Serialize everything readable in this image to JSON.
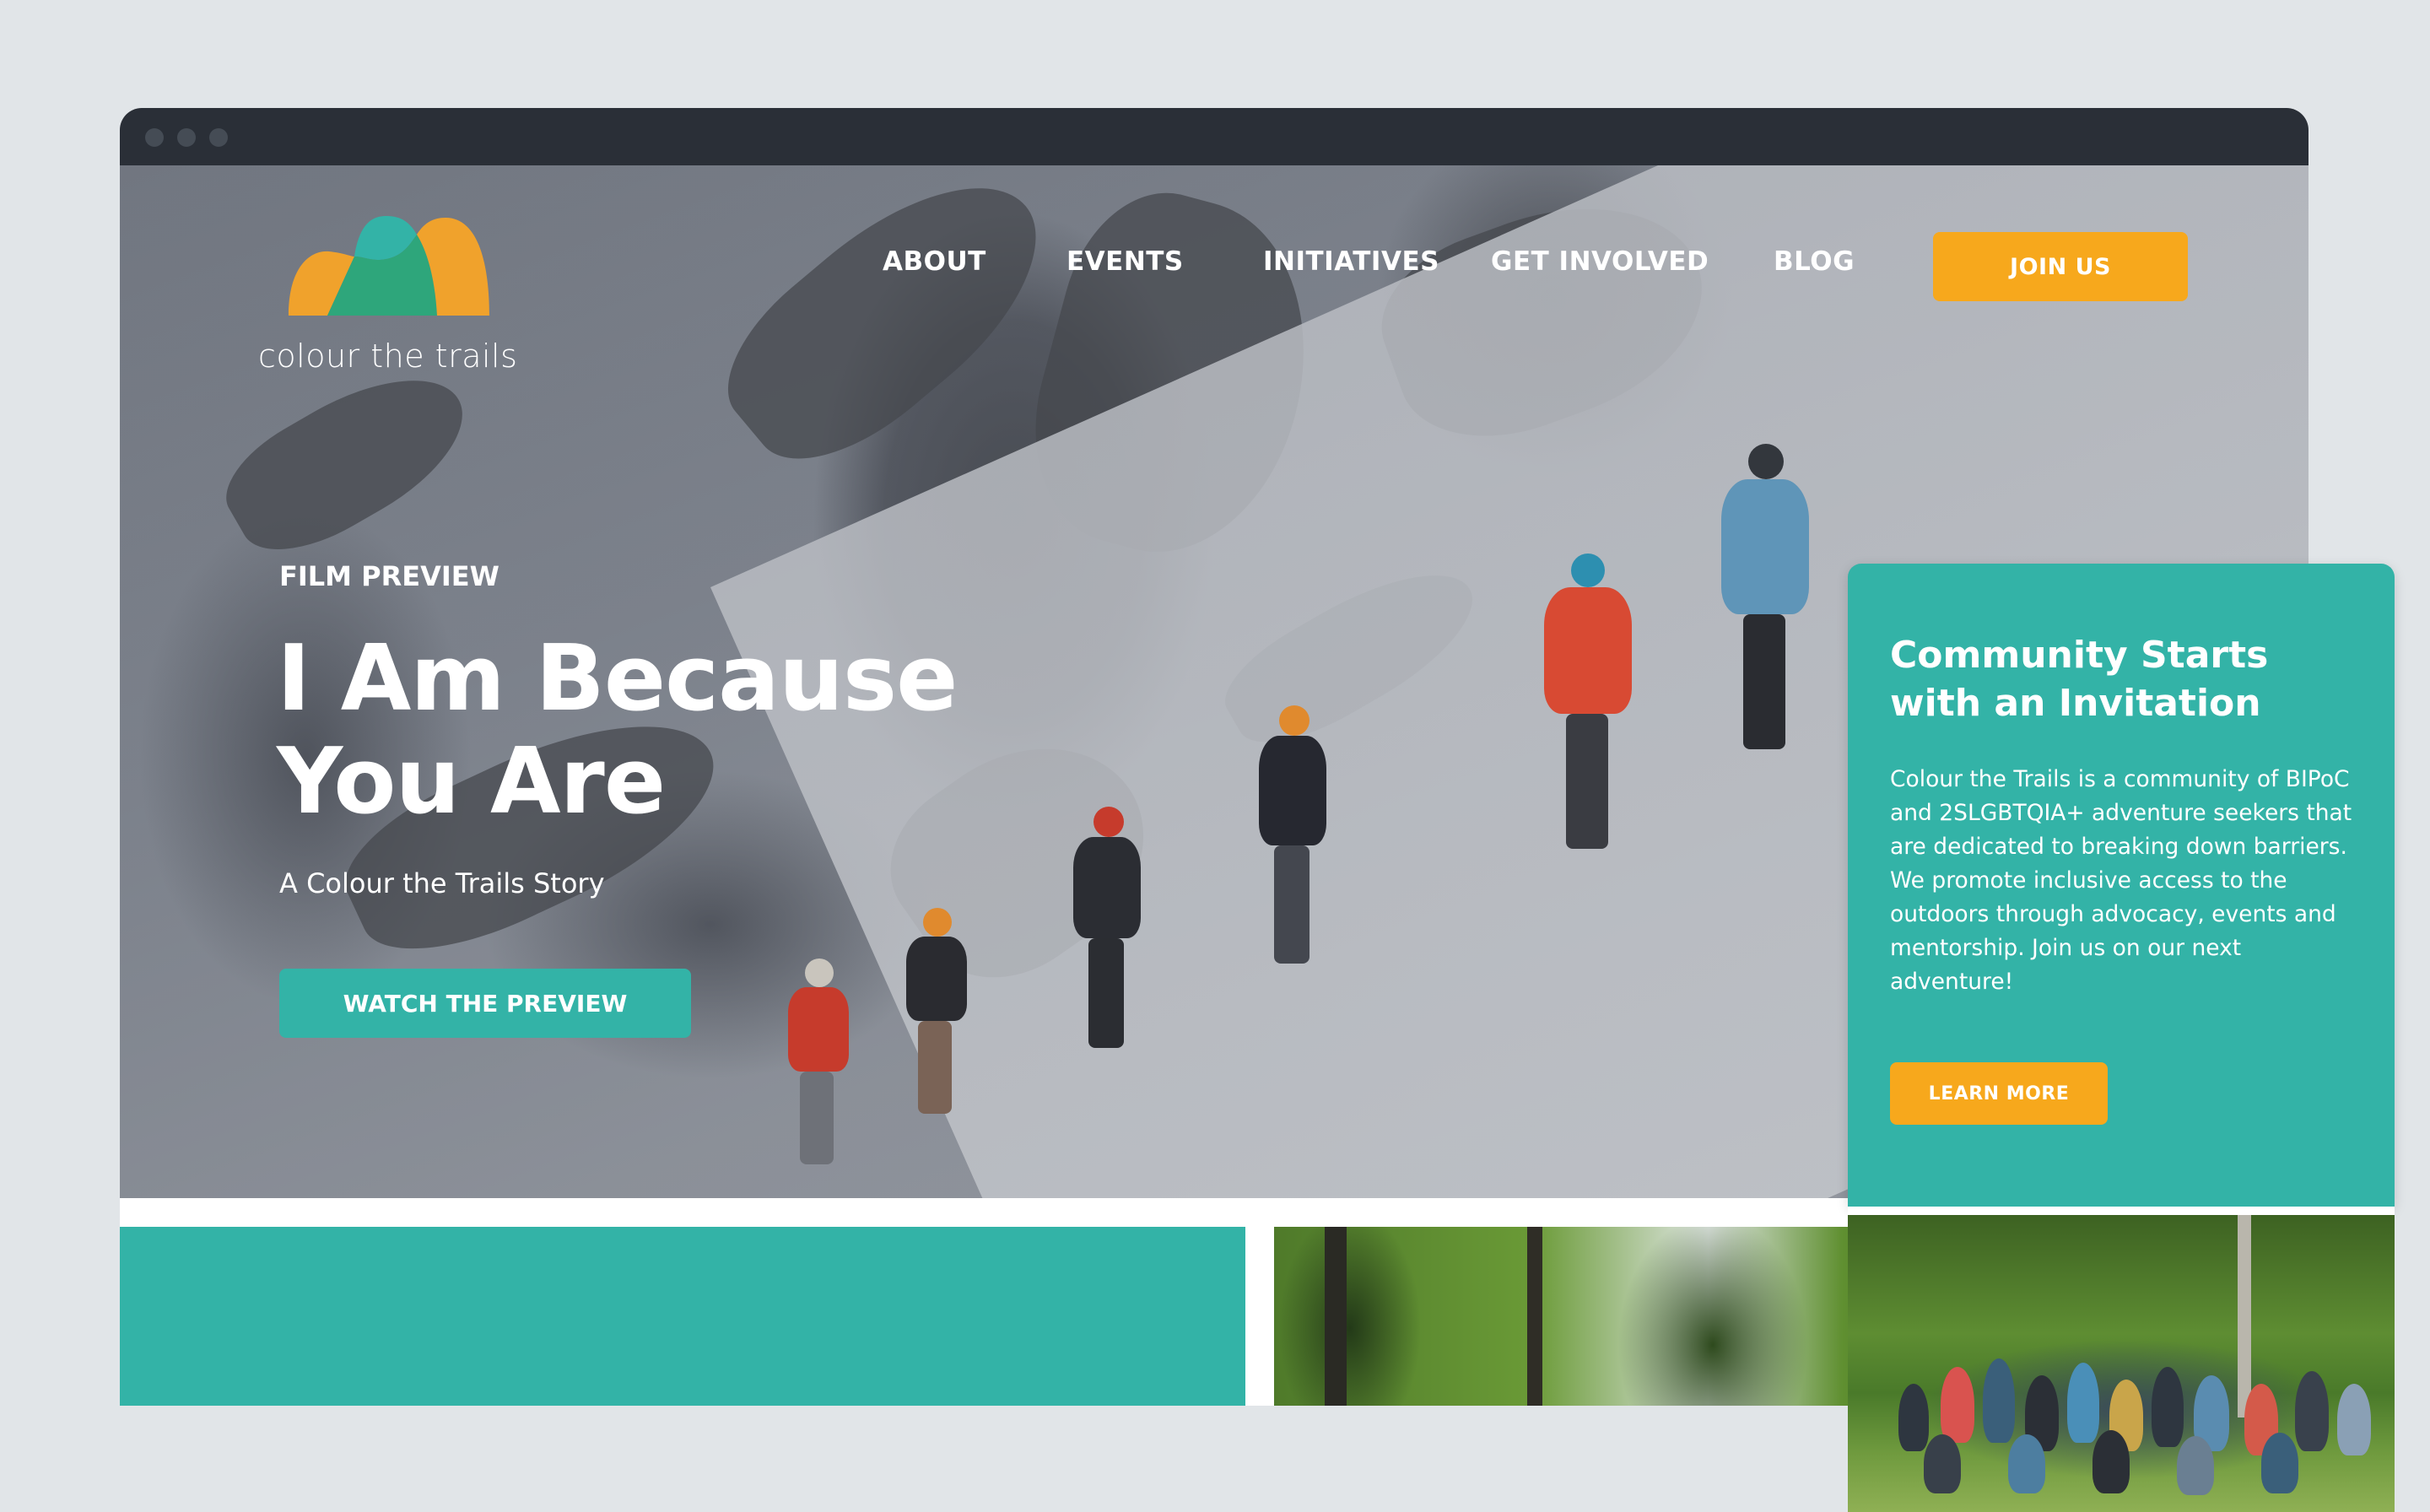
{
  "brand": {
    "name": "colour the trails",
    "colors": {
      "teal": "#33b3a7",
      "orange": "#f7a81c",
      "green": "#2ea67b",
      "titlebar": "#2a2f37"
    }
  },
  "browser": {
    "window_controls": [
      "close-dot",
      "minimize-dot",
      "maximize-dot"
    ]
  },
  "nav": {
    "items": [
      {
        "label": "ABOUT"
      },
      {
        "label": "EVENTS"
      },
      {
        "label": "INITIATIVES"
      },
      {
        "label": "GET INVOLVED"
      },
      {
        "label": "BLOG"
      }
    ],
    "cta_label": "JOIN US"
  },
  "hero": {
    "eyebrow": "FILM PREVIEW",
    "headline_line1": "I Am Because",
    "headline_line2": "You Are",
    "subtitle": "A Colour the Trails Story",
    "cta_label": "WATCH THE PREVIEW",
    "image_description": "Group of hikers climbing a snowy mountain slope"
  },
  "card": {
    "title_line1": "Community Starts",
    "title_line2": "with an Invitation",
    "body": "Colour the Trails is a community of BIPoC and 2SLGBTQIA+ adventure seekers that are dedicated to breaking down barriers. We promote inclusive access to the outdoors through advocacy, events and mentorship. Join us on our next adventure!",
    "cta_label": "LEARN MORE",
    "image_description": "Group photo of community members on grass among trees"
  },
  "lower_section": {
    "image_description": "Forest canopy"
  }
}
